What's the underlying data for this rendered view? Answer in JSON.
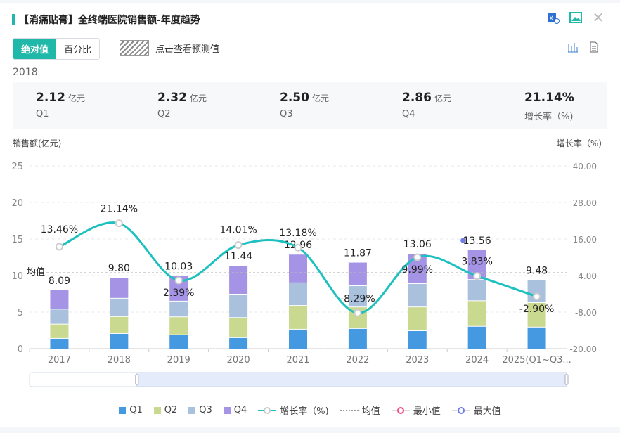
{
  "header": {
    "title": "【消痛贴膏】全终端医院销售额-年度趋势",
    "icons": [
      "excel-export-icon",
      "image-export-icon",
      "close-icon"
    ]
  },
  "toolbar": {
    "mode_options": [
      "绝对值",
      "百分比"
    ],
    "active_mode": "绝对值",
    "prediction_label": "点击查看预测值",
    "view_icons": [
      "bar-chart-icon",
      "table-icon"
    ]
  },
  "summary": {
    "year": "2018",
    "items": [
      {
        "value": "2.12",
        "unit": "亿元",
        "label": "Q1"
      },
      {
        "value": "2.32",
        "unit": "亿元",
        "label": "Q2"
      },
      {
        "value": "2.50",
        "unit": "亿元",
        "label": "Q3"
      },
      {
        "value": "2.86",
        "unit": "亿元",
        "label": "Q4"
      },
      {
        "value": "21.14%",
        "unit": "",
        "label": "增长率（%)"
      }
    ]
  },
  "chart_data": {
    "type": "bar+line",
    "ylabel": "销售额(亿元)",
    "ylabel_right": "增长率（%)",
    "ylim": [
      0,
      25
    ],
    "yticks": [
      "0",
      "5",
      "10",
      "15",
      "20",
      "25"
    ],
    "ylim_right": [
      -20,
      40
    ],
    "yticks_right": [
      "-20.00",
      "-8.00",
      "4.00",
      "16.00",
      "28.00",
      "40.00"
    ],
    "categories": [
      "2017",
      "2018",
      "2019",
      "2020",
      "2021",
      "2022",
      "2023",
      "2024",
      "2025(Q1~Q3..."
    ],
    "series": [
      {
        "name": "Q1",
        "color": "#4599e0",
        "values": [
          1.45,
          2.12,
          1.95,
          1.55,
          2.7,
          2.8,
          2.5,
          3.1,
          3.0
        ]
      },
      {
        "name": "Q2",
        "color": "#c9d98f",
        "values": [
          1.95,
          2.32,
          2.45,
          2.75,
          3.25,
          2.95,
          3.25,
          3.5,
          3.35
        ]
      },
      {
        "name": "Q3",
        "color": "#a9c1dc",
        "values": [
          2.05,
          2.5,
          2.15,
          3.2,
          3.1,
          2.9,
          3.2,
          2.9,
          3.13
        ]
      },
      {
        "name": "Q4",
        "color": "#a593e6",
        "values": [
          2.64,
          2.86,
          3.48,
          3.94,
          3.91,
          3.22,
          4.11,
          4.06,
          null
        ]
      }
    ],
    "totals": [
      "8.09",
      "9.80",
      "10.03",
      "11.44",
      "12.96",
      "11.87",
      "13.06",
      "13.56",
      "9.48"
    ],
    "growth": {
      "name": "增长率（%)",
      "color": "#1ec0c0",
      "values": [
        13.46,
        21.14,
        2.39,
        14.01,
        13.18,
        -8.29,
        9.99,
        3.83,
        -2.9
      ],
      "labels": [
        "13.46%",
        "21.14%",
        "2.39%",
        "14.01%",
        "13.18%",
        "-8.29%",
        "9.99%",
        "3.83%",
        "-2.90%"
      ]
    },
    "mean": {
      "name": "均值",
      "label": "均值",
      "value": 10.4
    },
    "max_marker": {
      "name": "最大值",
      "category": "2024",
      "color": "#6f7be8"
    },
    "min_marker": {
      "name": "最小值",
      "color": "#f0508a"
    },
    "grid": true,
    "legend_position": "bottom",
    "zoom_range": [
      0.2,
      1.0
    ]
  }
}
